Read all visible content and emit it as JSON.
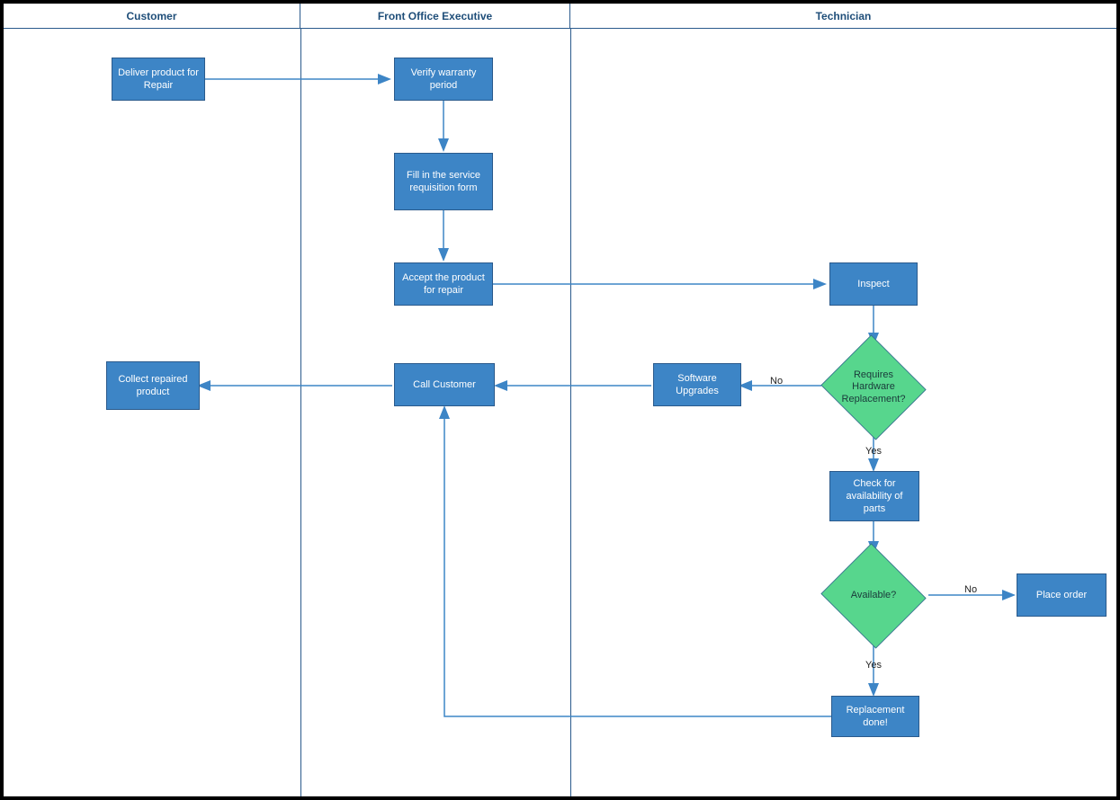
{
  "lanes": {
    "customer": "Customer",
    "frontOffice": "Front Office Executive",
    "technician": "Technician"
  },
  "nodes": {
    "deliver": "Deliver product for Repair",
    "verify": "Verify warranty period",
    "fillForm": "Fill in the service requisition form",
    "accept": "Accept the product for repair",
    "inspect": "Inspect",
    "reqHardware": "Requires Hardware Replacement?",
    "softUpg": "Software Upgrades",
    "callCustomer": "Call Customer",
    "collect": "Collect repaired product",
    "checkParts": "Check for availability of parts",
    "available": "Available?",
    "placeOrder": "Place order",
    "replacementDone": "Replacement done!"
  },
  "edgeLabels": {
    "no": "No",
    "yes": "Yes"
  },
  "colors": {
    "process": "#3d85c6",
    "decision": "#57d68d",
    "border": "#2a5a8c",
    "laneText": "#1f4e79"
  }
}
